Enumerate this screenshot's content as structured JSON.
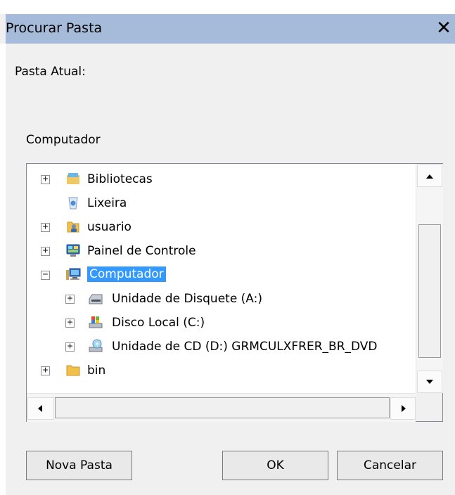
{
  "dialog": {
    "title": "Procurar Pasta",
    "close_glyph": "✕",
    "current_folder_label": "Pasta Atual:",
    "selected_folder": "Computador"
  },
  "tree": {
    "items": [
      {
        "label": "Bibliotecas",
        "icon": "libraries-icon",
        "expander": "+"
      },
      {
        "label": "Lixeira",
        "icon": "recycle-bin-icon",
        "expander": ""
      },
      {
        "label": "usuario",
        "icon": "user-folder-icon",
        "expander": "+"
      },
      {
        "label": "Painel de Controle",
        "icon": "control-panel-icon",
        "expander": "+"
      },
      {
        "label": "Computador",
        "icon": "computer-icon",
        "expander": "−",
        "selected": true
      },
      {
        "label": "Unidade de Disquete (A:)",
        "icon": "floppy-drive-icon",
        "expander": "+"
      },
      {
        "label": "Disco Local (C:)",
        "icon": "local-disk-icon",
        "expander": "+"
      },
      {
        "label": "Unidade de CD (D:) GRMCULXFRER_BR_DVD",
        "icon": "cd-drive-icon",
        "expander": "+"
      },
      {
        "label": "bin",
        "icon": "folder-icon",
        "expander": "+"
      }
    ]
  },
  "buttons": {
    "new_folder": "Nova Pasta",
    "ok": "OK",
    "cancel": "Cancelar"
  },
  "colors": {
    "titlebar": "#a6bbd9",
    "selection": "#3399ff",
    "dialog_bg": "#f0f0f0"
  }
}
